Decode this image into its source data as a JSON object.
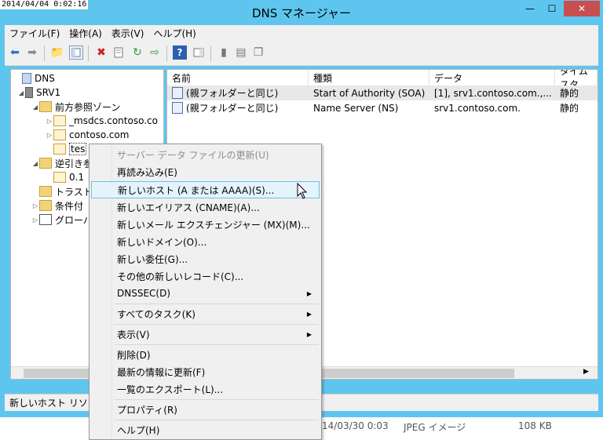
{
  "timestamp": "2014/04/04 0:02:16",
  "window": {
    "title": "DNS マネージャー",
    "minimize": "—",
    "maximize": "☐",
    "close": "✕"
  },
  "menu": [
    "ファイル(F)",
    "操作(A)",
    "表示(V)",
    "ヘルプ(H)"
  ],
  "tree": {
    "root": "DNS",
    "server": "SRV1",
    "forward": "前方参照ゾーン",
    "msdcs": "_msdcs.contoso.co",
    "contoso": "contoso.com",
    "test": "tes",
    "reverse": "逆引き参",
    "rev01": "0.1",
    "trust": "トラスト",
    "conditional": "条件付",
    "global": "グローバ"
  },
  "list": {
    "columns": [
      "名前",
      "種類",
      "データ",
      "タイムスタ"
    ],
    "rows": [
      {
        "name": "(親フォルダーと同じ)",
        "type": "Start of Authority (SOA)",
        "data": "[1], srv1.contoso.com.,...",
        "ts": "静的"
      },
      {
        "name": "(親フォルダーと同じ)",
        "type": "Name Server (NS)",
        "data": "srv1.contoso.com.",
        "ts": "静的"
      }
    ]
  },
  "status": "新しいホスト リソース",
  "bottom_row": {
    "date": "14/03/30 0:03",
    "type": "JPEG イメージ",
    "size": "108 KB"
  },
  "context_menu": {
    "items": [
      "サーバー データ ファイルの更新(U)",
      "再読み込み(E)",
      "新しいホスト (A または AAAA)(S)...",
      "新しいエイリアス (CNAME)(A)...",
      "新しいメール エクスチェンジャー (MX)(M)...",
      "新しいドメイン(O)...",
      "新しい委任(G)...",
      "その他の新しいレコード(C)...",
      "DNSSEC(D)",
      "すべてのタスク(K)",
      "表示(V)",
      "削除(D)",
      "最新の情報に更新(F)",
      "一覧のエクスポート(L)...",
      "プロパティ(R)",
      "ヘルプ(H)"
    ],
    "submenu_arrow": "▶"
  },
  "colors": {
    "titlebar": "#5ec6ee",
    "close": "#c74f4f",
    "menu_highlight": "#e5f3fb"
  }
}
